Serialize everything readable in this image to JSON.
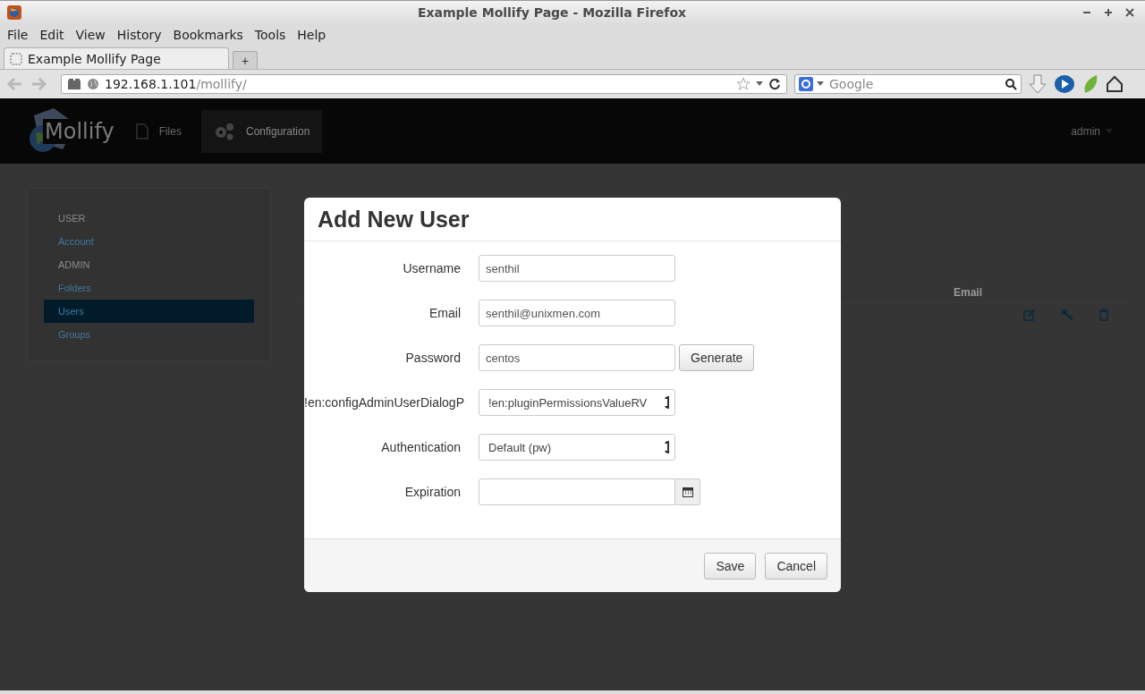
{
  "window": {
    "title": "Example Mollify Page - Mozilla Firefox"
  },
  "menu": [
    "File",
    "Edit",
    "View",
    "History",
    "Bookmarks",
    "Tools",
    "Help"
  ],
  "tabs": [
    {
      "label": "Example Mollify Page",
      "selected": true
    }
  ],
  "new_tab": "+",
  "address": {
    "host": "192.168.1.101",
    "path": "/mollify/"
  },
  "search": {
    "placeholder": "Google"
  },
  "app": {
    "logo": "Mollify",
    "nav": [
      {
        "label": "Files",
        "selected": false
      },
      {
        "label": "Configuration",
        "selected": true
      }
    ],
    "user_menu": "admin"
  },
  "sidebar": {
    "items": [
      {
        "label": "USER",
        "kind": "header",
        "selected": false
      },
      {
        "label": "Account",
        "kind": "link",
        "selected": false
      },
      {
        "label": "ADMIN",
        "kind": "header",
        "selected": false
      },
      {
        "label": "Folders",
        "kind": "link",
        "selected": false
      },
      {
        "label": "Users",
        "kind": "link",
        "selected": true
      },
      {
        "label": "Groups",
        "kind": "link",
        "selected": false
      }
    ]
  },
  "table": {
    "columns": [
      "Email"
    ]
  },
  "dialog": {
    "title": "Add New User",
    "fields": [
      {
        "label": "Username",
        "kind": "text",
        "value": "senthil"
      },
      {
        "label": "Email",
        "kind": "text",
        "value": "senthil@unixmen.com"
      },
      {
        "label": "Password",
        "kind": "text",
        "value": "centos",
        "button": "Generate"
      },
      {
        "label": "!en:configAdminUserDialogP",
        "kind": "select",
        "value": "!en:pluginPermissionsValueRV"
      },
      {
        "label": "Authentication",
        "kind": "select",
        "value": "Default (pw)"
      },
      {
        "label": "Expiration",
        "kind": "date"
      }
    ],
    "buttons": [
      "Save",
      "Cancel"
    ]
  }
}
